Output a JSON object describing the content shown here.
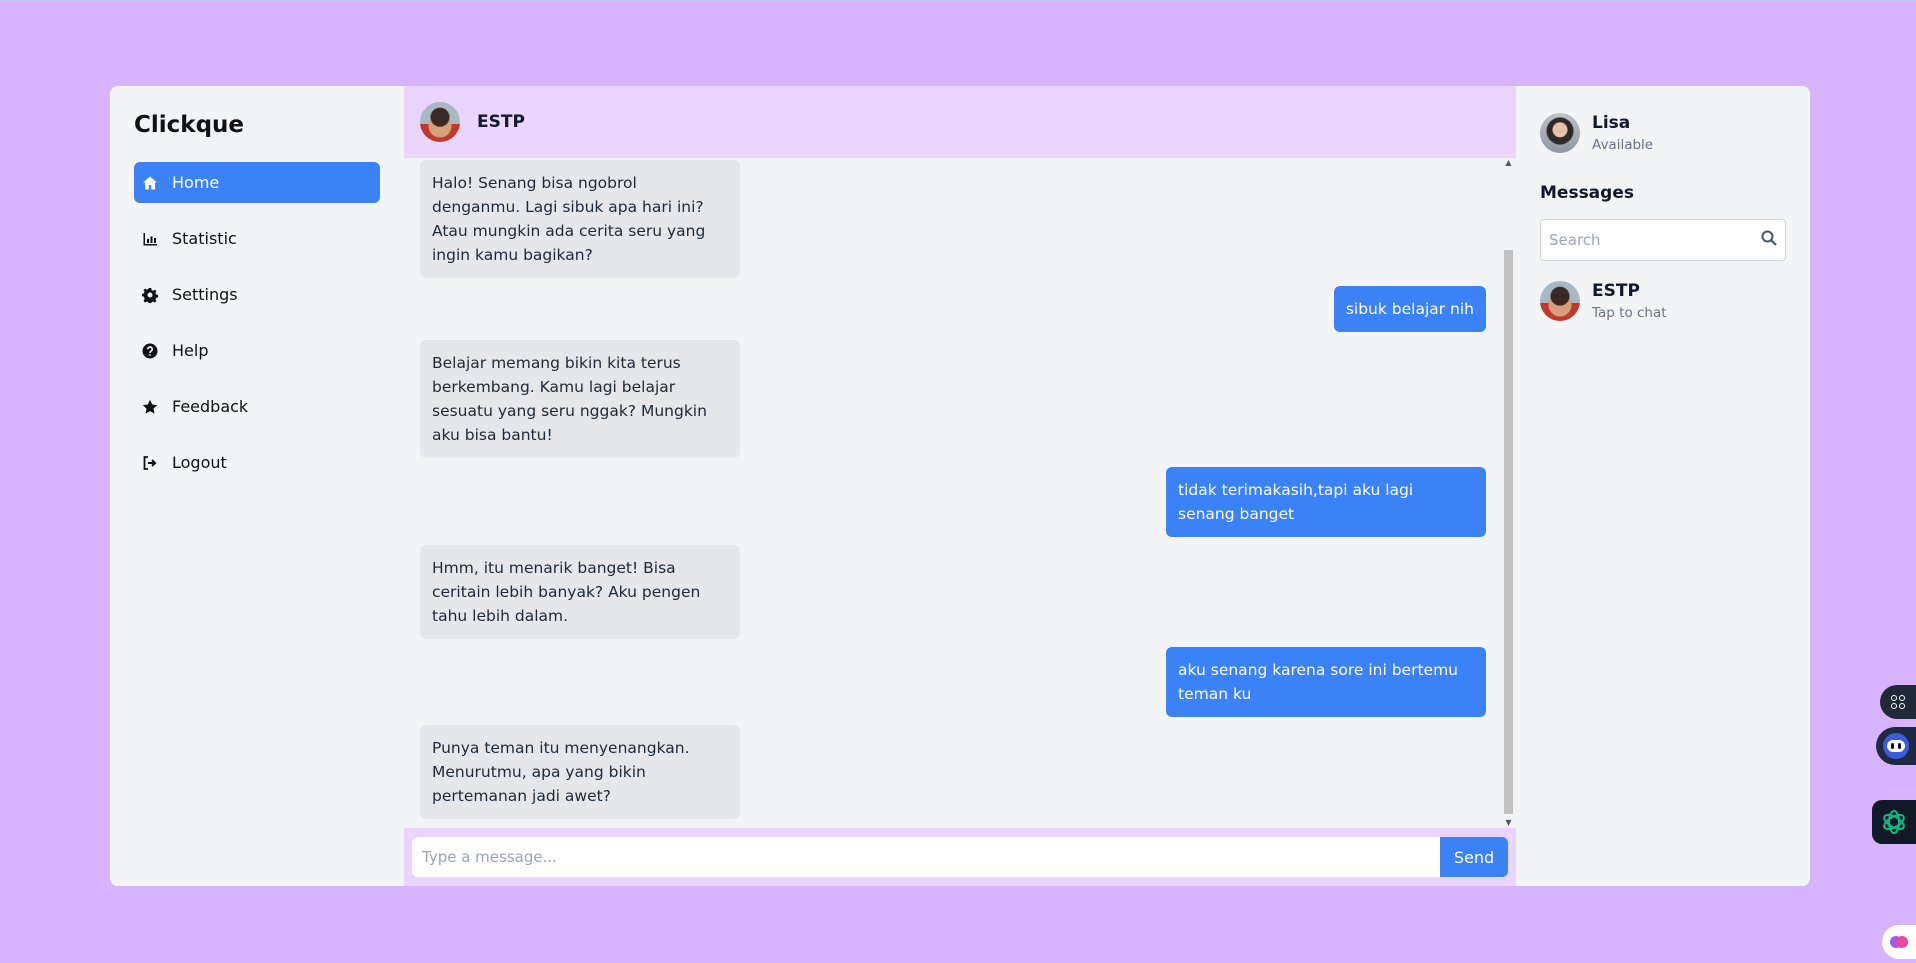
{
  "nav": {
    "brand": "Clickque",
    "items": [
      {
        "label": "Home",
        "icon": "home-icon"
      },
      {
        "label": "Statistic",
        "icon": "chart-icon"
      },
      {
        "label": "Settings",
        "icon": "gear-icon"
      },
      {
        "label": "Help",
        "icon": "help-icon"
      },
      {
        "label": "Feedback",
        "icon": "star-icon"
      },
      {
        "label": "Logout",
        "icon": "logout-icon"
      }
    ]
  },
  "chat": {
    "contact_name": "ESTP",
    "messages": [
      {
        "from": "bot",
        "text": "Halo! Senang bisa ngobrol denganmu. Lagi sibuk apa hari ini? Atau mungkin ada cerita seru yang ingin kamu bagikan?"
      },
      {
        "from": "user",
        "text": "sibuk belajar nih"
      },
      {
        "from": "bot",
        "text": "Belajar memang bikin kita terus berkembang. Kamu lagi belajar sesuatu yang seru nggak? Mungkin aku bisa bantu!"
      },
      {
        "from": "user",
        "text": "tidak terimakasih,tapi aku lagi senang banget"
      },
      {
        "from": "bot",
        "text": "Hmm, itu menarik banget! Bisa ceritain lebih banyak? Aku pengen tahu lebih dalam."
      },
      {
        "from": "user",
        "text": "aku senang karena sore ini bertemu teman ku"
      },
      {
        "from": "bot",
        "text": "Punya teman itu menyenangkan. Menurutmu, apa yang bikin pertemanan jadi awet?"
      }
    ],
    "input_placeholder": "Type a message...",
    "send_label": "Send"
  },
  "side": {
    "user_name": "Lisa",
    "user_status": "Available",
    "title": "Messages",
    "search_placeholder": "Search",
    "contacts": [
      {
        "name": "ESTP",
        "subtitle": "Tap to chat"
      }
    ]
  },
  "colors": {
    "background": "#d8b4fe",
    "accent": "#3b82f6",
    "header": "#ead5fe"
  }
}
